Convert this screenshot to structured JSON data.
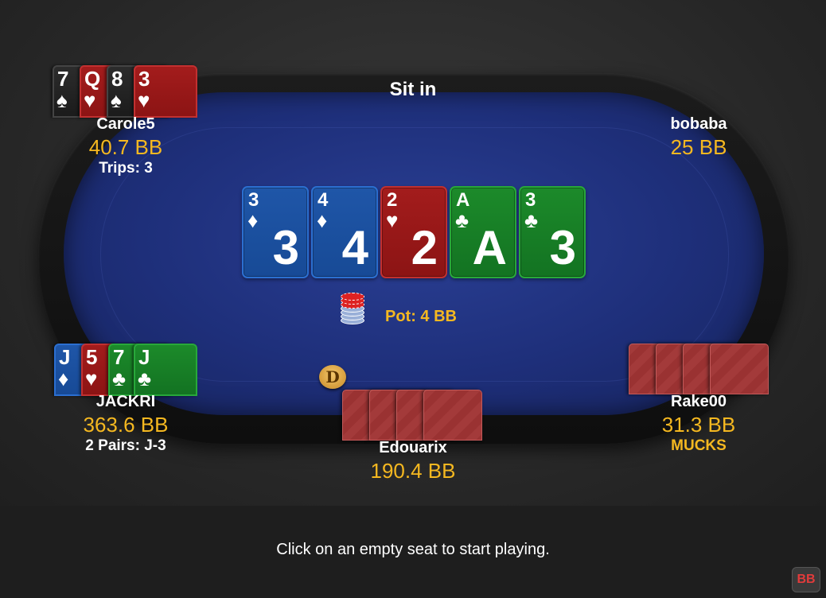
{
  "table": {
    "sit_in_label": "Sit in",
    "pot_label": "Pot: 4 BB",
    "dealer_button": "D"
  },
  "board": [
    {
      "rank": "3",
      "suit": "♦",
      "color": "blue"
    },
    {
      "rank": "4",
      "suit": "♦",
      "color": "blue"
    },
    {
      "rank": "2",
      "suit": "♥",
      "color": "red"
    },
    {
      "rank": "A",
      "suit": "♣",
      "color": "green"
    },
    {
      "rank": "3",
      "suit": "♣",
      "color": "green"
    }
  ],
  "players": {
    "carole": {
      "name": "Carole5",
      "stack": "40.7 BB",
      "hand_label": "Trips: 3",
      "cards": [
        {
          "rank": "7",
          "suit": "♠",
          "color": "black"
        },
        {
          "rank": "Q",
          "suit": "♥",
          "color": "red"
        },
        {
          "rank": "8",
          "suit": "♠",
          "color": "black"
        },
        {
          "rank": "3",
          "suit": "♥",
          "color": "red"
        }
      ]
    },
    "bobaba": {
      "name": "bobaba",
      "stack": "25 BB"
    },
    "jackri": {
      "name": "JACKRI",
      "stack": "363.6 BB",
      "hand_label": "2 Pairs: J-3",
      "cards": [
        {
          "rank": "J",
          "suit": "♦",
          "color": "blue"
        },
        {
          "rank": "5",
          "suit": "♥",
          "color": "red"
        },
        {
          "rank": "7",
          "suit": "♣",
          "color": "green"
        },
        {
          "rank": "J",
          "suit": "♣",
          "color": "green"
        }
      ]
    },
    "rake": {
      "name": "Rake00",
      "stack": "31.3 BB",
      "status": "MUCKS"
    },
    "edouarix": {
      "name": "Edouarix",
      "stack": "190.4 BB"
    }
  },
  "footer": {
    "message": "Click on an empty seat to start playing.",
    "bb_button": "BB"
  },
  "colors": {
    "felt": "#1e2f7a",
    "accent": "#f5b820",
    "card_back": "#a33a3a"
  }
}
